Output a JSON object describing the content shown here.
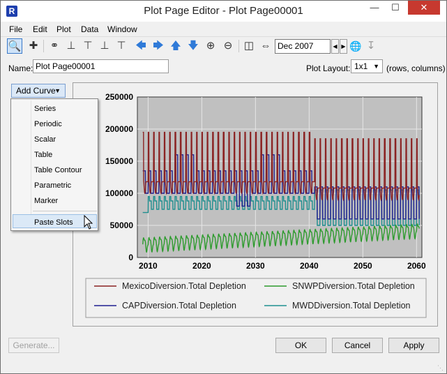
{
  "window": {
    "title": "Plot Page Editor - Plot Page00001",
    "app_icon": "R"
  },
  "menu": [
    "File",
    "Edit",
    "Plot",
    "Data",
    "Window"
  ],
  "toolbar": {
    "date": "Dec 2007"
  },
  "name": {
    "label": "Name:",
    "value": "Plot Page00001"
  },
  "layout": {
    "label": "Plot Layout:",
    "value": "1x1",
    "hint": "(rows, columns)"
  },
  "add_curve": {
    "label": "Add Curve",
    "items": [
      "Series",
      "Periodic",
      "Scalar",
      "Table",
      "Table Contour",
      "Parametric",
      "Marker"
    ],
    "paste": "Paste Slots"
  },
  "buttons": {
    "generate": "Generate...",
    "ok": "OK",
    "cancel": "Cancel",
    "apply": "Apply"
  },
  "chart_data": {
    "type": "line",
    "x_range": [
      2008,
      2061
    ],
    "ylim": [
      0,
      250000
    ],
    "yticks": [
      "0",
      "50000",
      "100000",
      "150000",
      "200000",
      "250000"
    ],
    "xticks": [
      "2010",
      "2020",
      "2030",
      "2040",
      "2050",
      "2060"
    ],
    "grid": true,
    "legend_position": "bottom",
    "series": [
      {
        "name": "MexicoDiversion.Total Depletion",
        "color": "#8b2323",
        "approx_range": [
          100000,
          210000
        ]
      },
      {
        "name": "SNWPDiversion.Total Depletion",
        "color": "#2e9b2e",
        "approx_range": [
          20000,
          55000
        ]
      },
      {
        "name": "CAPDiversion.Total Depletion",
        "color": "#1f1f8f",
        "approx_range": [
          60000,
          160000
        ]
      },
      {
        "name": "MWDDiversion.Total Depletion",
        "color": "#1f8f8f",
        "approx_range": [
          45000,
          115000
        ]
      }
    ]
  }
}
